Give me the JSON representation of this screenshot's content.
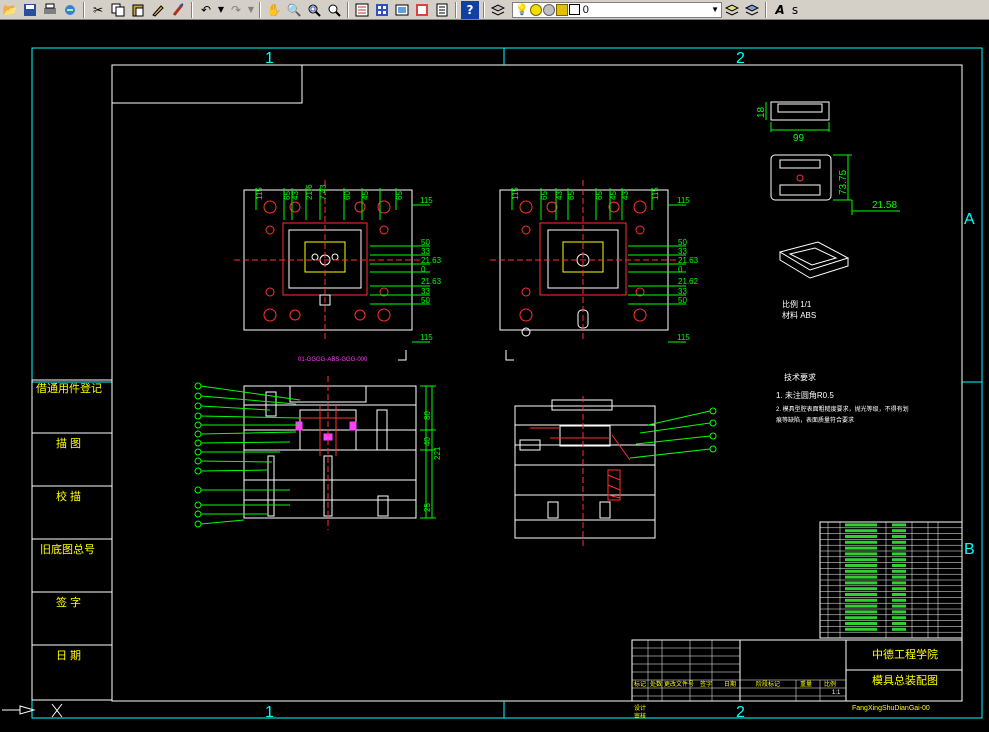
{
  "toolbar": {
    "layer_name": "0",
    "layer_dropdown_arrow": "▼",
    "icons": [
      "open-icon",
      "save-icon",
      "print-icon",
      "plot-icon",
      "cut-icon",
      "copy-icon",
      "paste-icon",
      "match-props-icon",
      "brush-icon",
      "undo-icon",
      "redo-icon",
      "pan-icon",
      "zoom-realtime-icon",
      "zoom-window-icon",
      "zoom-prev-icon",
      "properties-icon",
      "design-center-icon",
      "tool-palette-icon",
      "sheet-set-icon",
      "markup-icon",
      "calc-icon",
      "help-icon",
      "layer-manager-icon",
      "lightbulb-icon",
      "sun-icon",
      "freeze-icon",
      "lock-icon",
      "color-square",
      "layer-prev-icon",
      "layer-state-icon",
      "text-style-icon"
    ]
  },
  "drawing": {
    "zone_top_1": "1",
    "zone_top_2": "2",
    "zone_bottom_1": "1",
    "zone_bottom_2": "2",
    "zone_right_a": "A",
    "zone_right_b": "B",
    "side_labels": [
      "借通用件登记",
      "描 图",
      "校 描",
      "旧底图总号",
      "签 字",
      "日 期"
    ],
    "dim_99": "99",
    "dim_18": "18",
    "dim_73_75": "73.75",
    "dim_21_58": "21.58",
    "part_note_1": "比例 1/1",
    "part_note_2": "材料 ABS",
    "tech_title": "技术要求",
    "tech_1": "1. 未注圆角R0.5",
    "tech_2": "2. 模具型腔表面粗糙度要求，抛光等级，不得有划",
    "tech_3": "痕等缺陷，表面质量符合要求",
    "plan_dims_left": [
      "115",
      "65",
      "43",
      "7.43",
      "60",
      "45",
      "65"
    ],
    "plan_dims_right_vals": [
      "115",
      "50",
      "33",
      "21.63",
      "0",
      "21.63",
      "33",
      "50",
      "115"
    ],
    "section_dim_221": "221",
    "section_dim_80": "80",
    "section_dim_40": "40",
    "section_dim_25": "25",
    "plan_caption": "01-GGGG-ABS-GGG-000",
    "title_block": {
      "school": "中德工程学院",
      "drawing_name": "模具总装配图",
      "code": "FangXingShuDianGai-00",
      "scale": "1:1",
      "weight_label": "重量",
      "ratio_label": "比例"
    }
  }
}
